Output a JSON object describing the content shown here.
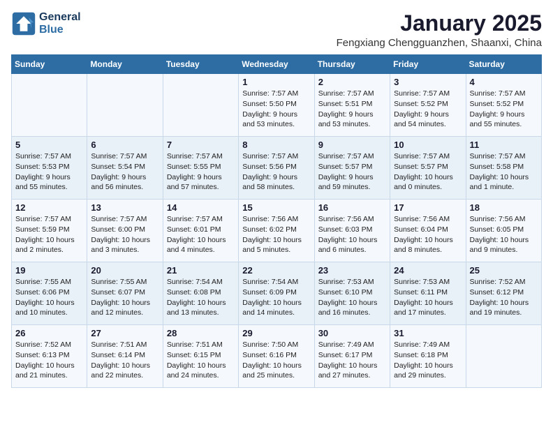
{
  "logo": {
    "line1": "General",
    "line2": "Blue"
  },
  "title": "January 2025",
  "subtitle": "Fengxiang Chengguanzhen, Shaanxi, China",
  "weekdays": [
    "Sunday",
    "Monday",
    "Tuesday",
    "Wednesday",
    "Thursday",
    "Friday",
    "Saturday"
  ],
  "weeks": [
    [
      {
        "day": "",
        "info": ""
      },
      {
        "day": "",
        "info": ""
      },
      {
        "day": "",
        "info": ""
      },
      {
        "day": "1",
        "info": "Sunrise: 7:57 AM\nSunset: 5:50 PM\nDaylight: 9 hours and 53 minutes."
      },
      {
        "day": "2",
        "info": "Sunrise: 7:57 AM\nSunset: 5:51 PM\nDaylight: 9 hours and 53 minutes."
      },
      {
        "day": "3",
        "info": "Sunrise: 7:57 AM\nSunset: 5:52 PM\nDaylight: 9 hours and 54 minutes."
      },
      {
        "day": "4",
        "info": "Sunrise: 7:57 AM\nSunset: 5:52 PM\nDaylight: 9 hours and 55 minutes."
      }
    ],
    [
      {
        "day": "5",
        "info": "Sunrise: 7:57 AM\nSunset: 5:53 PM\nDaylight: 9 hours and 55 minutes."
      },
      {
        "day": "6",
        "info": "Sunrise: 7:57 AM\nSunset: 5:54 PM\nDaylight: 9 hours and 56 minutes."
      },
      {
        "day": "7",
        "info": "Sunrise: 7:57 AM\nSunset: 5:55 PM\nDaylight: 9 hours and 57 minutes."
      },
      {
        "day": "8",
        "info": "Sunrise: 7:57 AM\nSunset: 5:56 PM\nDaylight: 9 hours and 58 minutes."
      },
      {
        "day": "9",
        "info": "Sunrise: 7:57 AM\nSunset: 5:57 PM\nDaylight: 9 hours and 59 minutes."
      },
      {
        "day": "10",
        "info": "Sunrise: 7:57 AM\nSunset: 5:57 PM\nDaylight: 10 hours and 0 minutes."
      },
      {
        "day": "11",
        "info": "Sunrise: 7:57 AM\nSunset: 5:58 PM\nDaylight: 10 hours and 1 minute."
      }
    ],
    [
      {
        "day": "12",
        "info": "Sunrise: 7:57 AM\nSunset: 5:59 PM\nDaylight: 10 hours and 2 minutes."
      },
      {
        "day": "13",
        "info": "Sunrise: 7:57 AM\nSunset: 6:00 PM\nDaylight: 10 hours and 3 minutes."
      },
      {
        "day": "14",
        "info": "Sunrise: 7:57 AM\nSunset: 6:01 PM\nDaylight: 10 hours and 4 minutes."
      },
      {
        "day": "15",
        "info": "Sunrise: 7:56 AM\nSunset: 6:02 PM\nDaylight: 10 hours and 5 minutes."
      },
      {
        "day": "16",
        "info": "Sunrise: 7:56 AM\nSunset: 6:03 PM\nDaylight: 10 hours and 6 minutes."
      },
      {
        "day": "17",
        "info": "Sunrise: 7:56 AM\nSunset: 6:04 PM\nDaylight: 10 hours and 8 minutes."
      },
      {
        "day": "18",
        "info": "Sunrise: 7:56 AM\nSunset: 6:05 PM\nDaylight: 10 hours and 9 minutes."
      }
    ],
    [
      {
        "day": "19",
        "info": "Sunrise: 7:55 AM\nSunset: 6:06 PM\nDaylight: 10 hours and 10 minutes."
      },
      {
        "day": "20",
        "info": "Sunrise: 7:55 AM\nSunset: 6:07 PM\nDaylight: 10 hours and 12 minutes."
      },
      {
        "day": "21",
        "info": "Sunrise: 7:54 AM\nSunset: 6:08 PM\nDaylight: 10 hours and 13 minutes."
      },
      {
        "day": "22",
        "info": "Sunrise: 7:54 AM\nSunset: 6:09 PM\nDaylight: 10 hours and 14 minutes."
      },
      {
        "day": "23",
        "info": "Sunrise: 7:53 AM\nSunset: 6:10 PM\nDaylight: 10 hours and 16 minutes."
      },
      {
        "day": "24",
        "info": "Sunrise: 7:53 AM\nSunset: 6:11 PM\nDaylight: 10 hours and 17 minutes."
      },
      {
        "day": "25",
        "info": "Sunrise: 7:52 AM\nSunset: 6:12 PM\nDaylight: 10 hours and 19 minutes."
      }
    ],
    [
      {
        "day": "26",
        "info": "Sunrise: 7:52 AM\nSunset: 6:13 PM\nDaylight: 10 hours and 21 minutes."
      },
      {
        "day": "27",
        "info": "Sunrise: 7:51 AM\nSunset: 6:14 PM\nDaylight: 10 hours and 22 minutes."
      },
      {
        "day": "28",
        "info": "Sunrise: 7:51 AM\nSunset: 6:15 PM\nDaylight: 10 hours and 24 minutes."
      },
      {
        "day": "29",
        "info": "Sunrise: 7:50 AM\nSunset: 6:16 PM\nDaylight: 10 hours and 25 minutes."
      },
      {
        "day": "30",
        "info": "Sunrise: 7:49 AM\nSunset: 6:17 PM\nDaylight: 10 hours and 27 minutes."
      },
      {
        "day": "31",
        "info": "Sunrise: 7:49 AM\nSunset: 6:18 PM\nDaylight: 10 hours and 29 minutes."
      },
      {
        "day": "",
        "info": ""
      }
    ]
  ]
}
